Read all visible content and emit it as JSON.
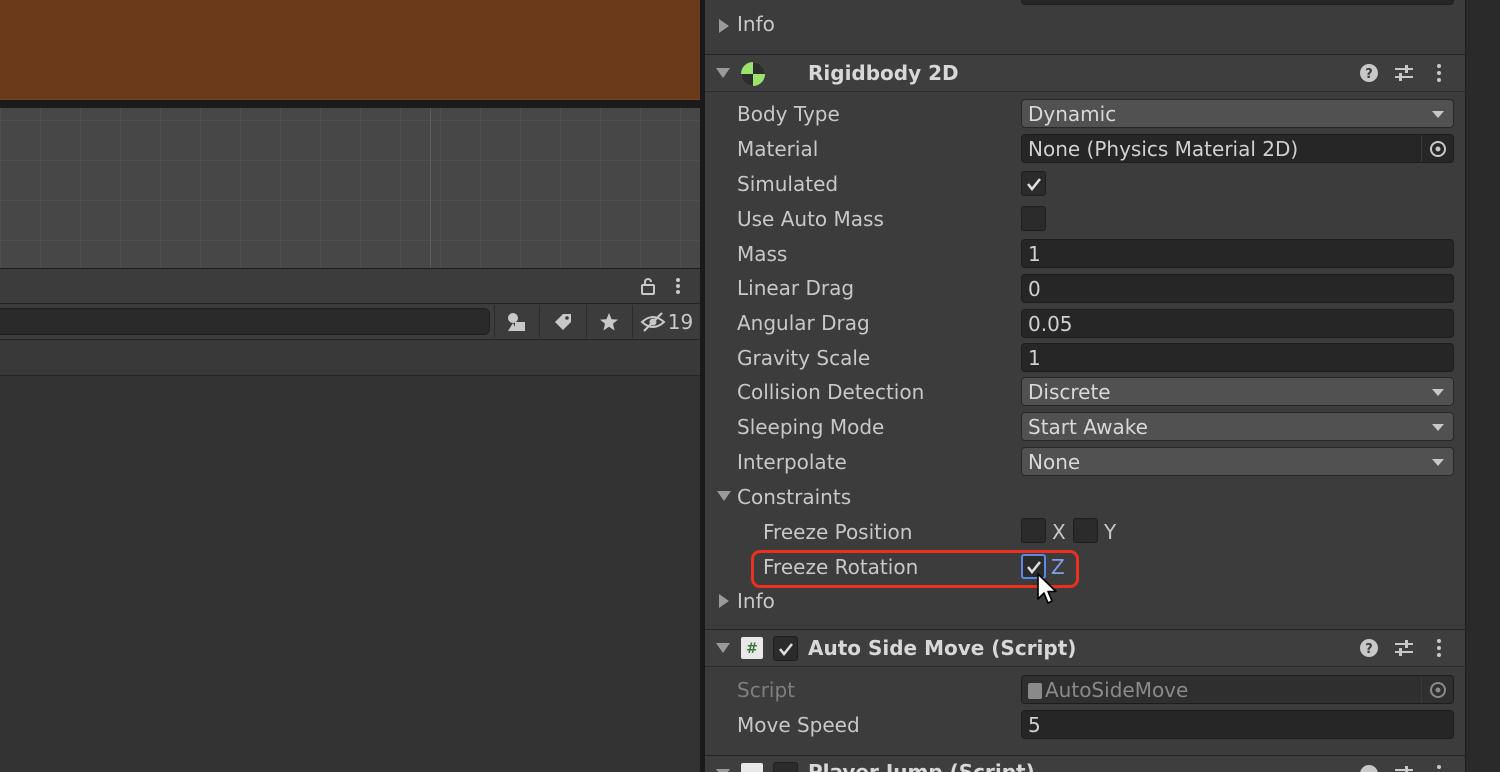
{
  "project": {
    "hidden_count": "19"
  },
  "inspector": {
    "top_info_label": "Info",
    "rigidbody": {
      "title": "Rigidbody 2D",
      "body_type_label": "Body Type",
      "body_type_value": "Dynamic",
      "material_label": "Material",
      "material_value": "None (Physics Material 2D)",
      "simulated_label": "Simulated",
      "simulated_checked": true,
      "use_auto_mass_label": "Use Auto Mass",
      "use_auto_mass_checked": false,
      "mass_label": "Mass",
      "mass_value": "1",
      "linear_drag_label": "Linear Drag",
      "linear_drag_value": "0",
      "angular_drag_label": "Angular Drag",
      "angular_drag_value": "0.05",
      "gravity_scale_label": "Gravity Scale",
      "gravity_scale_value": "1",
      "collision_detection_label": "Collision Detection",
      "collision_detection_value": "Discrete",
      "sleeping_mode_label": "Sleeping Mode",
      "sleeping_mode_value": "Start Awake",
      "interpolate_label": "Interpolate",
      "interpolate_value": "None",
      "constraints_label": "Constraints",
      "freeze_position_label": "Freeze Position",
      "freeze_x_label": "X",
      "freeze_y_label": "Y",
      "freeze_rotation_label": "Freeze Rotation",
      "freeze_z_label": "Z",
      "info_label": "Info"
    },
    "auto_side_move": {
      "title": "Auto Side Move (Script)",
      "script_label": "Script",
      "script_value": "AutoSideMove",
      "move_speed_label": "Move Speed",
      "move_speed_value": "5"
    },
    "player_jump": {
      "title": "Player Jump (Script)"
    }
  },
  "colors": {
    "highlight": "#e8311e",
    "rigidbody_icon": "#9be36d",
    "accent_blue": "#7da2e8"
  }
}
